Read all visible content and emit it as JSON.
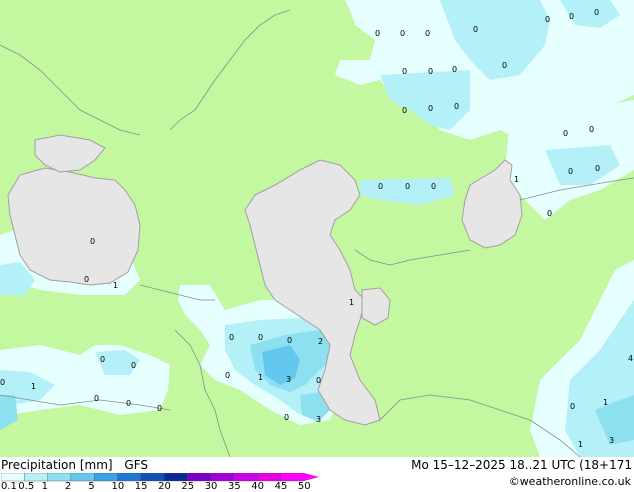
{
  "header": {
    "product_label": "Precipitation [mm]",
    "model_label": "GFS",
    "valid_time": "Mo 15–12–2025 18..21 UTC (18+171",
    "credit": "©weatheronline.co.uk"
  },
  "colors": {
    "land": "#c3f7a0",
    "sea": "#e6e6e6",
    "coast": "#a0a0a0",
    "border": "#8c8c8c",
    "scale": [
      "#e6ffff",
      "#b4f0f8",
      "#8ce0f0",
      "#64c8ee",
      "#3ca0e6",
      "#1e78d2",
      "#1450b4",
      "#0a2896",
      "#7800c8",
      "#a000dc",
      "#c800e6",
      "#e600e6",
      "#ff00ff"
    ]
  },
  "legend": {
    "ticks": [
      "0.1",
      "0.5",
      "1",
      "2",
      "5",
      "10",
      "15",
      "20",
      "25",
      "30",
      "35",
      "40",
      "45",
      "50"
    ]
  },
  "values": {
    "v_north_a": "0",
    "v_north_b": "0",
    "v_north_c": "0",
    "v_north_d": "0",
    "v_north_e": "0",
    "v_north_f": "0",
    "v_north_g": "0",
    "v_n2_a": "0",
    "v_n2_b": "0",
    "v_n2_c": "0",
    "v_n2_d": "0",
    "v_n3_a": "0",
    "v_n3_b": "0",
    "v_n3_c": "0",
    "v_east_a": "0",
    "v_east_b": "0",
    "v_east_c": "0",
    "v_east_d": "1",
    "v_east_e": "0",
    "v_aral_a": "1",
    "v_aral_b": "0",
    "v_kz_a": "0",
    "v_kz_b": "0",
    "v_kz_c": "0",
    "v_bs_a": "0",
    "v_bs_b": "0",
    "v_bs_c": "1",
    "v_cau_a": "1",
    "v_cau_b": "0",
    "v_cau_c": "2",
    "v_cau_d": "0",
    "v_cau_e": "0",
    "v_cau_f": "3",
    "v_cau_g": "0",
    "v_cau_h": "0",
    "v_cau_i": "3",
    "v_cau_j": "1",
    "v_tr_a": "0",
    "v_tr_b": "0",
    "v_tr_c": "0",
    "v_tr_d": "1",
    "v_tr_e": "0",
    "v_tr_f": "0",
    "v_tr_g": "0",
    "v_se_a": "0",
    "v_se_b": "1",
    "v_se_c": "1",
    "v_se_d": "3",
    "v_se_e": "4"
  }
}
